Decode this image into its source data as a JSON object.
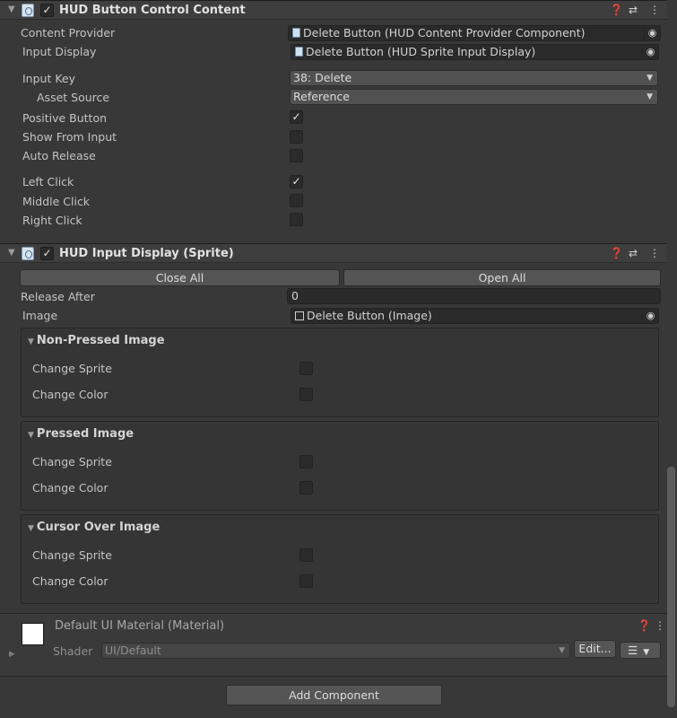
{
  "component1": {
    "title": "HUD Button Control Content",
    "content_provider_label": "Content Provider",
    "content_provider_value": "Delete Button (HUD Content Provider Component)",
    "input_display_label": "Input Display",
    "input_display_value": "Delete Button (HUD Sprite Input Display)",
    "input_key_label": "Input Key",
    "input_key_value": "38: Delete",
    "asset_source_label": "Asset Source",
    "asset_source_value": "Reference",
    "positive_button_label": "Positive Button",
    "show_from_input_label": "Show From Input",
    "auto_release_label": "Auto Release",
    "left_click_label": "Left Click",
    "middle_click_label": "Middle Click",
    "right_click_label": "Right Click",
    "positive_button_checked": true,
    "show_from_input_checked": false,
    "auto_release_checked": false,
    "left_click_checked": true,
    "middle_click_checked": false,
    "right_click_checked": false
  },
  "component2": {
    "title": "HUD Input Display (Sprite)",
    "close_all_label": "Close All",
    "open_all_label": "Open All",
    "release_after_label": "Release After",
    "release_after_value": "0",
    "image_label": "Image",
    "image_value": "Delete Button (Image)",
    "groups": [
      {
        "title": "Non-Pressed Image",
        "change_sprite_label": "Change Sprite",
        "change_color_label": "Change Color"
      },
      {
        "title": "Pressed Image",
        "change_sprite_label": "Change Sprite",
        "change_color_label": "Change Color"
      },
      {
        "title": "Cursor Over Image",
        "change_sprite_label": "Change Sprite",
        "change_color_label": "Change Color"
      }
    ]
  },
  "material": {
    "name": "Default UI Material (Material)",
    "shader_label": "Shader",
    "shader_value": "UI/Default",
    "edit_label": "Edit..."
  },
  "add_component_label": "Add Component",
  "check_glyph": "✓",
  "icons": {
    "help": "help-icon",
    "settings": "preset-sliders-icon",
    "menu": "kebab-menu-icon",
    "target": "object-picker-icon",
    "fold": "foldout-arrow-icon"
  }
}
